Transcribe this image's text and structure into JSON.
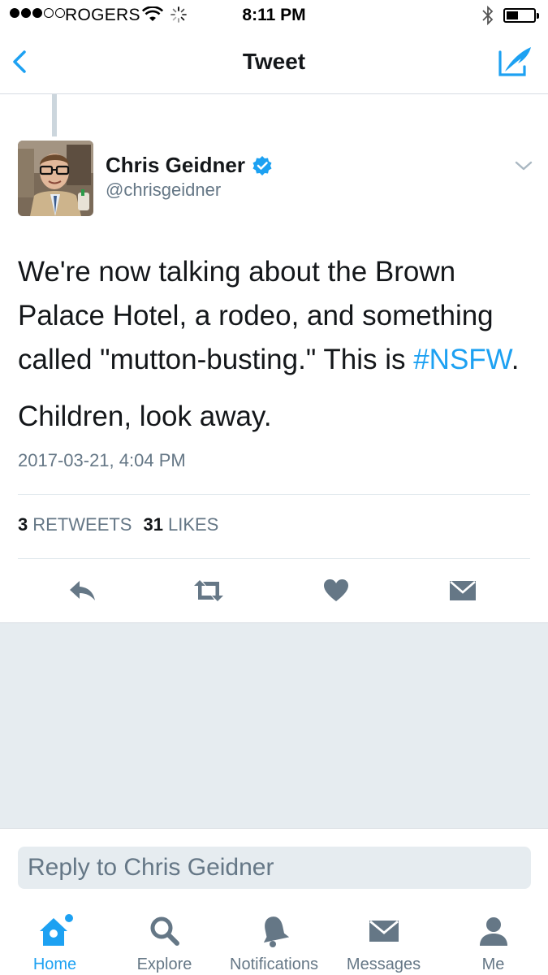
{
  "status_bar": {
    "carrier": "ROGERS",
    "time": "8:11 PM"
  },
  "nav": {
    "title": "Tweet"
  },
  "tweet": {
    "author_name": "Chris Geidner",
    "author_handle": "@chrisgeidner",
    "text_line1_before": "We're now talking about the Brown Palace Hotel, a rodeo, and something called \"mutton-busting.\" This is ",
    "hashtag": "#NSFW",
    "text_line1_after": ".",
    "text_paragraph2": "Children, look away.",
    "timestamp": "2017-03-21, 4:04 PM",
    "retweet_count": "3",
    "retweet_label": "RETWEETS",
    "like_count": "31",
    "like_label": "LIKES"
  },
  "reply": {
    "placeholder": "Reply to Chris Geidner"
  },
  "tabs": [
    {
      "label": "Home",
      "icon": "home-icon",
      "active": true
    },
    {
      "label": "Explore",
      "icon": "search-icon",
      "active": false
    },
    {
      "label": "Notifications",
      "icon": "bell-icon",
      "active": false
    },
    {
      "label": "Messages",
      "icon": "envelope-icon",
      "active": false
    },
    {
      "label": "Me",
      "icon": "person-icon",
      "active": false
    }
  ],
  "colors": {
    "accent": "#1da1f2",
    "secondary_text": "#657786",
    "action_icons": "#657786",
    "background_gray": "#e6ecf0"
  }
}
